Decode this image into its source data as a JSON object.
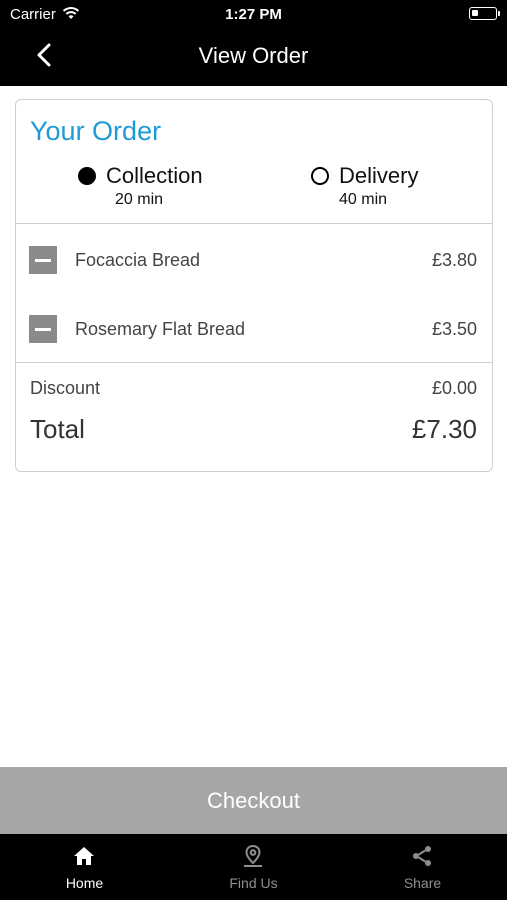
{
  "status_bar": {
    "carrier": "Carrier",
    "time": "1:27 PM"
  },
  "nav": {
    "title": "View Order"
  },
  "order": {
    "title": "Your Order",
    "options": [
      {
        "label": "Collection",
        "time": "20 min",
        "selected": true
      },
      {
        "label": "Delivery",
        "time": "40 min",
        "selected": false
      }
    ],
    "items": [
      {
        "name": "Focaccia Bread",
        "price": "£3.80"
      },
      {
        "name": "Rosemary Flat Bread",
        "price": "£3.50"
      }
    ],
    "discount_label": "Discount",
    "discount_value": "£0.00",
    "total_label": "Total",
    "total_value": "£7.30"
  },
  "checkout": {
    "label": "Checkout"
  },
  "tabs": [
    {
      "label": "Home",
      "icon": "home-icon",
      "active": true
    },
    {
      "label": "Find Us",
      "icon": "location-pin-icon",
      "active": false
    },
    {
      "label": "Share",
      "icon": "share-icon",
      "active": false
    }
  ],
  "colors": {
    "accent": "#1e9ad6",
    "bar_background": "#000000",
    "checkout_background": "#a6a6a6",
    "inactive_tab": "#8e8e8e"
  }
}
